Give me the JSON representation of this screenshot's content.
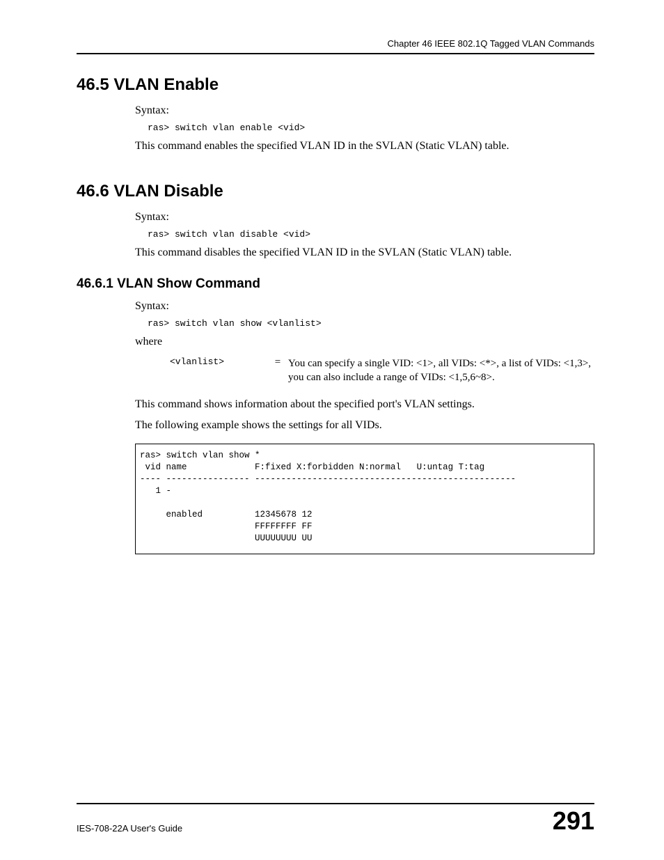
{
  "header": {
    "chapter": "Chapter 46 IEEE 802.1Q Tagged VLAN Commands"
  },
  "sections": {
    "s46_5": {
      "number_title": "46.5  VLAN Enable",
      "syntax_label": "Syntax:",
      "code": "ras> switch vlan enable <vid>",
      "desc": "This command enables the specified VLAN ID in the SVLAN (Static VLAN) table."
    },
    "s46_6": {
      "number_title": "46.6  VLAN Disable",
      "syntax_label": "Syntax:",
      "code": "ras> switch vlan disable <vid>",
      "desc": "This command disables the specified VLAN ID in the SVLAN (Static VLAN) table."
    },
    "s46_6_1": {
      "number_title": "46.6.1  VLAN Show Command",
      "syntax_label": "Syntax:",
      "code": "ras> switch vlan show <vlanlist>",
      "where_label": "where",
      "where_param": "<vlanlist>",
      "where_eq": "=",
      "where_desc": "You can specify a single VID: <1>, all VIDs: <*>, a list of VIDs: <1,3>, you can also include a range of VIDs: <1,5,6~8>.",
      "desc1": "This command shows information about the specified port's VLAN settings.",
      "desc2": "The following example shows the settings for all VIDs.",
      "example": "ras> switch vlan show *\n vid name             F:fixed X:forbidden N:normal   U:untag T:tag\n---- ---------------- --------------------------------------------------\n   1 -\n\n     enabled          12345678 12\n                      FFFFFFFF FF\n                      UUUUUUUU UU"
    }
  },
  "footer": {
    "guide": "IES-708-22A User's Guide",
    "page": "291"
  }
}
